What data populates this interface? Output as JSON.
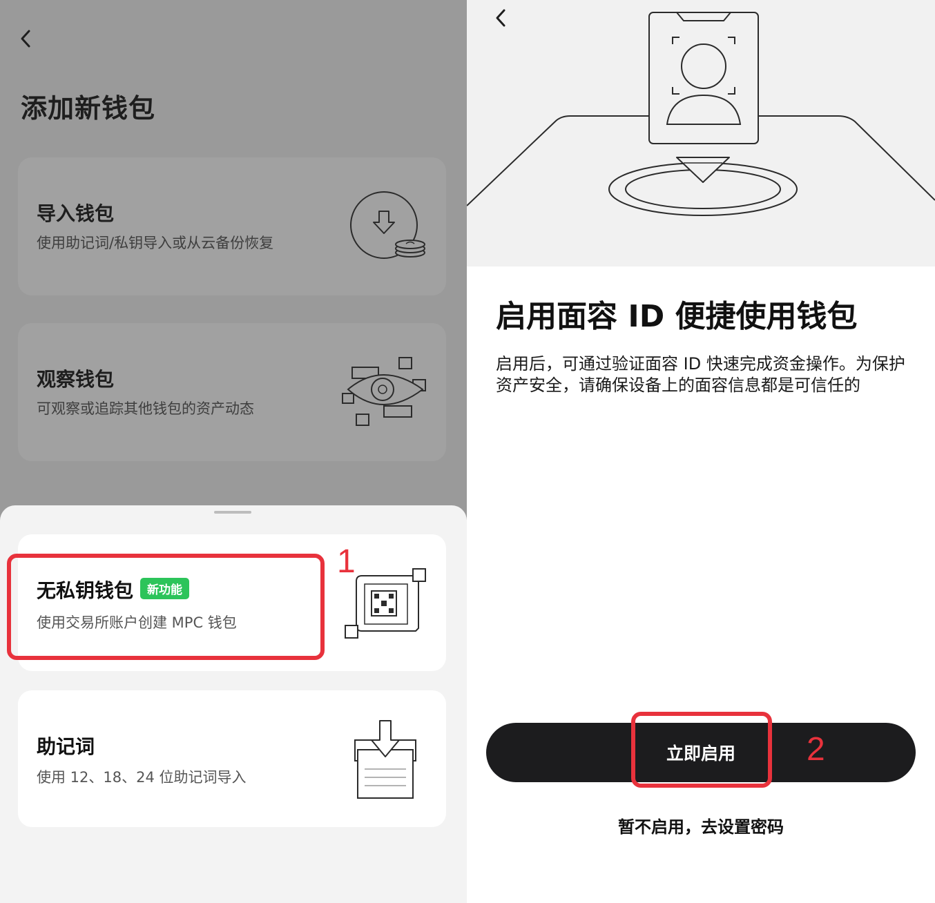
{
  "left_screen": {
    "page_title": "添加新钱包",
    "cards": [
      {
        "title": "导入钱包",
        "subtitle": "使用助记词/私钥导入或从云备份恢复",
        "icon": "import-download-icon"
      },
      {
        "title": "观察钱包",
        "subtitle": "可观察或追踪其他钱包的资产动态",
        "icon": "watch-eye-icon"
      }
    ],
    "sheet_options": [
      {
        "title": "无私钥钱包",
        "badge": "新功能",
        "subtitle": "使用交易所账户创建 MPC 钱包",
        "icon": "mpc-qr-icon"
      },
      {
        "title": "助记词",
        "subtitle": "使用 12、18、24 位助记词导入",
        "icon": "mnemonic-tray-icon"
      }
    ],
    "step_label": "1"
  },
  "right_screen": {
    "title": "启用面容 ID 便捷使用钱包",
    "description": "启用后，可通过验证面容 ID 快速完成资金操作。为保护资产安全，请确保设备上的面容信息都是可信任的",
    "primary_button": "立即启用",
    "secondary_link": "暂不启用，去设置密码",
    "step_label": "2"
  },
  "colors": {
    "highlight": "#e8323c",
    "badge": "#2cc45a",
    "primary_button": "#1c1c1e"
  }
}
